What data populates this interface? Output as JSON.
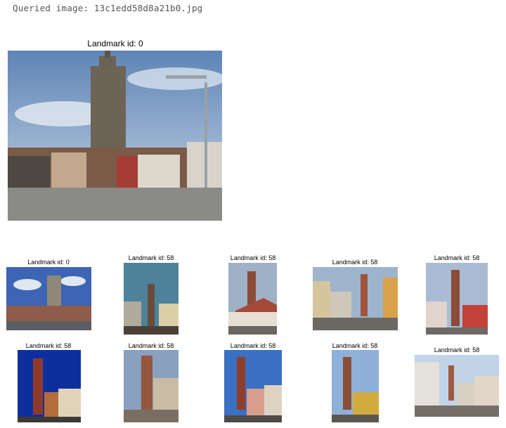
{
  "header": {
    "text": "Queried image: 13c1edd58d8a21b0.jpg"
  },
  "query": {
    "label": "Landmark id: 0"
  },
  "results": [
    {
      "label": "Landmark id: 0"
    },
    {
      "label": "Landmark id: 58"
    },
    {
      "label": "Landmark id: 58"
    },
    {
      "label": "Landmark id: 58"
    },
    {
      "label": "Landmark id: 58"
    },
    {
      "label": "Landmark id: 58"
    },
    {
      "label": "Landmark id: 58"
    },
    {
      "label": "Landmark id: 58"
    },
    {
      "label": "Landmark id: 58"
    },
    {
      "label": "Landmark id: 58"
    }
  ]
}
